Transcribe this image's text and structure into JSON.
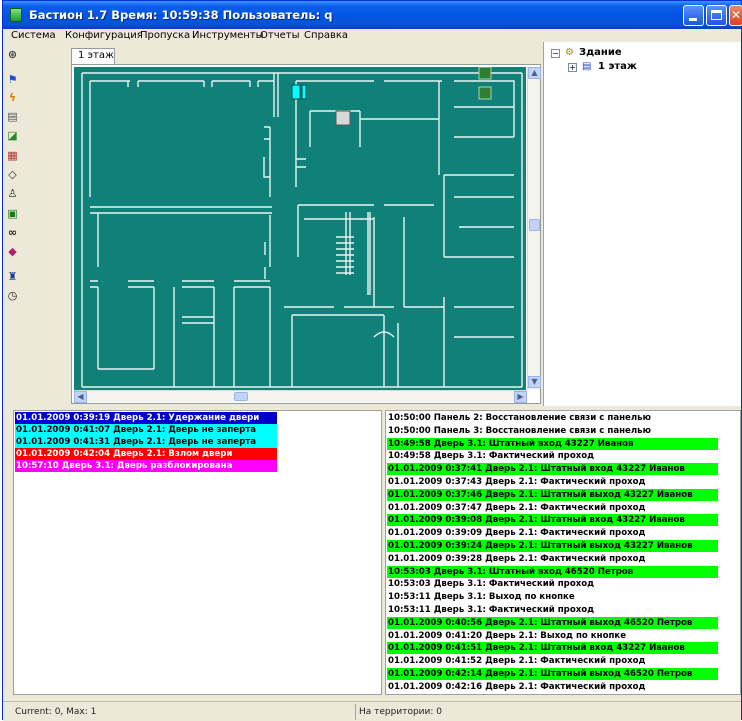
{
  "window": {
    "title": "Бастион 1.7 Время: 10:59:38 Пользователь: q",
    "minimize": "",
    "maximize": "",
    "close": "✕"
  },
  "menu": [
    "Система",
    "Конфигурация",
    "Пропуска",
    "Инструменты",
    "Отчеты",
    "Справка"
  ],
  "toolbar": {
    "icons": [
      "camera-icon",
      "flag-icon",
      "lightning-icon",
      "printer-icon",
      "device-icon",
      "keypad-icon",
      "tag-icon",
      "person-card-icon",
      "terminal-icon",
      "binoculars-icon",
      "eraser-icon",
      "door-person-icon",
      "stopwatch-icon"
    ]
  },
  "plan": {
    "tab_label": "1 этаж"
  },
  "tree": {
    "root": "Здание",
    "child": "1 этаж",
    "root_toggle": "−",
    "child_toggle": "+"
  },
  "colors": {
    "plan_background": "#0f8178",
    "alarm_blue": "#0000cc",
    "alarm_cyan": "#00ffff",
    "alarm_red": "#ff0000",
    "alarm_magenta": "#ff00ff",
    "event_green": "#00ff00"
  },
  "alarms": [
    {
      "text": "01.01.2009 0:39:19 Дверь   2.1: Удержание двери",
      "bg": "#0000cc",
      "fg": "#ffffff"
    },
    {
      "text": "01.01.2009 0:41:07 Дверь   2.1: Дверь не заперта",
      "bg": "#00ffff",
      "fg": "#000000"
    },
    {
      "text": "01.01.2009 0:41:31 Дверь   2.1: Дверь не заперта",
      "bg": "#00ffff",
      "fg": "#000000"
    },
    {
      "text": "01.01.2009 0:42:04 Дверь   2.1: Взлом двери",
      "bg": "#ff0000",
      "fg": "#ffffff"
    },
    {
      "text": "10:57:10 Дверь   3.1: Дверь разблокирована",
      "bg": "#ff00ff",
      "fg": "#ffffff"
    }
  ],
  "events": [
    {
      "text": "10:50:00 Панель   2: Восстановление связи с панелью",
      "highlight": false
    },
    {
      "text": "10:50:00 Панель   3: Восстановление связи с панелью",
      "highlight": false
    },
    {
      "text": "10:49:58 Дверь   3.1: Штатный вход 43227 Иванов",
      "highlight": true
    },
    {
      "text": "10:49:58 Дверь   3.1: Фактический проход",
      "highlight": false
    },
    {
      "text": "01.01.2009 0:37:41 Дверь   2.1: Штатный вход 43227 Иванов",
      "highlight": true
    },
    {
      "text": "01.01.2009 0:37:43 Дверь   2.1: Фактический проход",
      "highlight": false
    },
    {
      "text": "01.01.2009 0:37:46 Дверь   2.1: Штатный выход 43227 Иванов",
      "highlight": true
    },
    {
      "text": "01.01.2009 0:37:47 Дверь   2.1: Фактический проход",
      "highlight": false
    },
    {
      "text": "01.01.2009 0:39:08 Дверь   2.1: Штатный вход 43227 Иванов",
      "highlight": true
    },
    {
      "text": "01.01.2009 0:39:09 Дверь   2.1: Фактический проход",
      "highlight": false
    },
    {
      "text": "01.01.2009 0:39:24 Дверь   2.1: Штатный выход 43227 Иванов",
      "highlight": true
    },
    {
      "text": "01.01.2009 0:39:28 Дверь   2.1: Фактический проход",
      "highlight": false
    },
    {
      "text": "10:53:03 Дверь   3.1: Штатный вход 46520 Петров",
      "highlight": true
    },
    {
      "text": "10:53:03 Дверь   3.1: Фактический проход",
      "highlight": false
    },
    {
      "text": "10:53:11 Дверь   3.1: Выход по кнопке",
      "highlight": false
    },
    {
      "text": "10:53:11 Дверь   3.1: Фактический проход",
      "highlight": false
    },
    {
      "text": "01.01.2009 0:40:56 Дверь   2.1: Штатный выход 46520 Петров",
      "highlight": true
    },
    {
      "text": "01.01.2009 0:41:20 Дверь   2.1: Выход по кнопке",
      "highlight": false
    },
    {
      "text": "01.01.2009 0:41:51 Дверь   2.1: Штатный вход 43227 Иванов",
      "highlight": true
    },
    {
      "text": "01.01.2009 0:41:52 Дверь   2.1: Фактический проход",
      "highlight": false
    },
    {
      "text": "01.01.2009 0:42:14 Дверь   2.1: Штатный выход 46520 Петров",
      "highlight": true
    },
    {
      "text": "01.01.2009 0:42:16 Дверь   2.1: Фактический проход",
      "highlight": false
    }
  ],
  "status": {
    "left": "Current: 0, Max: 1",
    "right": "На территории: 0"
  }
}
